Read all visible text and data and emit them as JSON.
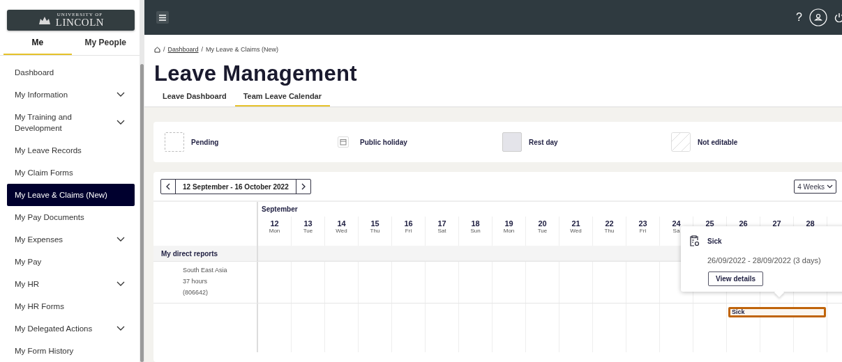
{
  "sidebar": {
    "logo": {
      "line1": "UNIVERSITY OF",
      "line2": "LINCOLN"
    },
    "tabs": [
      {
        "label": "Me",
        "selected": true
      },
      {
        "label": "My People",
        "selected": false
      }
    ],
    "items": [
      {
        "label": "Dashboard",
        "expandable": false,
        "selected": false
      },
      {
        "label": "My Information",
        "expandable": true,
        "selected": false
      },
      {
        "label": "My Training and Development",
        "expandable": true,
        "selected": false
      },
      {
        "label": "My Leave Records",
        "expandable": false,
        "selected": false
      },
      {
        "label": "My Claim Forms",
        "expandable": false,
        "selected": false
      },
      {
        "label": "My Leave & Claims (New)",
        "expandable": false,
        "selected": true
      },
      {
        "label": "My Pay Documents",
        "expandable": false,
        "selected": false
      },
      {
        "label": "My Expenses",
        "expandable": true,
        "selected": false
      },
      {
        "label": "My Pay",
        "expandable": false,
        "selected": false
      },
      {
        "label": "My HR",
        "expandable": true,
        "selected": false
      },
      {
        "label": "My HR Forms",
        "expandable": false,
        "selected": false
      },
      {
        "label": "My Delegated Actions",
        "expandable": true,
        "selected": false
      },
      {
        "label": "My Form History",
        "expandable": false,
        "selected": false
      }
    ]
  },
  "top_bar": {
    "help": "?"
  },
  "breadcrumb": {
    "separator": "/",
    "items": [
      "Dashboard",
      "My Leave & Claims (New)"
    ]
  },
  "title": "Leave Management",
  "page_tabs": [
    {
      "label": "Leave Dashboard",
      "selected": false
    },
    {
      "label": "Team Leave Calendar",
      "selected": true
    }
  ],
  "legend": [
    {
      "kind": "pending",
      "label": "Pending"
    },
    {
      "kind": "holiday",
      "label": "Public holiday"
    },
    {
      "kind": "rest",
      "label": "Rest day"
    },
    {
      "kind": "locked",
      "label": "Not editable"
    }
  ],
  "calendar": {
    "range": "12 September - 16 October 2022",
    "view": "4 Weeks",
    "month": "September",
    "days": [
      {
        "day": "12",
        "weekday": "Mon"
      },
      {
        "day": "13",
        "weekday": "Tue"
      },
      {
        "day": "14",
        "weekday": "Wed"
      },
      {
        "day": "15",
        "weekday": "Thu"
      },
      {
        "day": "16",
        "weekday": "Fri"
      },
      {
        "day": "17",
        "weekday": "Sat"
      },
      {
        "day": "18",
        "weekday": "Sun"
      },
      {
        "day": "19",
        "weekday": "Mon"
      },
      {
        "day": "20",
        "weekday": "Tue"
      },
      {
        "day": "21",
        "weekday": "Wed"
      },
      {
        "day": "22",
        "weekday": "Thu"
      },
      {
        "day": "23",
        "weekday": "Fri"
      },
      {
        "day": "24",
        "weekday": "Sa"
      },
      {
        "day": "25"
      },
      {
        "day": "26"
      },
      {
        "day": "27"
      },
      {
        "day": "28"
      }
    ],
    "group": "My direct reports",
    "rows": [
      {
        "lines": [
          "South East Asia",
          "37 hours",
          "(806642)"
        ]
      },
      {
        "leave_label": "Sick",
        "leave_days": [
          false,
          false,
          false,
          false,
          false,
          false,
          false,
          false,
          false,
          false,
          false,
          false,
          false,
          false,
          true,
          true,
          true
        ]
      }
    ],
    "tooltip": {
      "type": "Sick",
      "dates": "26/09/2022 - 28/09/2022 (3 days)",
      "button": "View details"
    }
  }
}
